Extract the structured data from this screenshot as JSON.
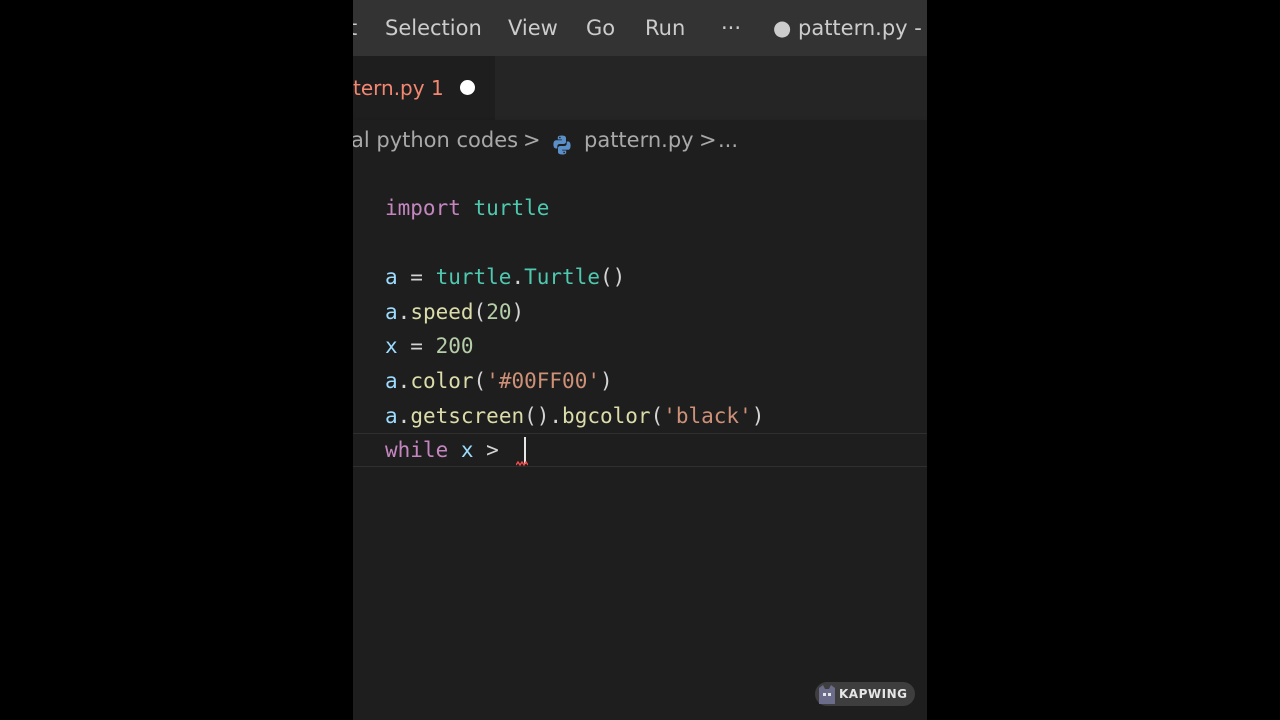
{
  "menubar": {
    "items": [
      "Selection",
      "View",
      "Go",
      "Run"
    ],
    "overflow": "···",
    "left_fragment": "t",
    "title": "● pattern.py - P"
  },
  "tab": {
    "label": "tern.py 1",
    "dirty_indicator": "●"
  },
  "breadcrumb": {
    "folder": "al python codes",
    "separator": ">",
    "file": "pattern.py",
    "trail": "..."
  },
  "editor": {
    "lines": [
      [
        {
          "t": "import",
          "c": "kw"
        },
        {
          "t": " ",
          "c": "op"
        },
        {
          "t": "turtle",
          "c": "mod"
        }
      ],
      [],
      [
        {
          "t": "a",
          "c": "var"
        },
        {
          "t": " = ",
          "c": "op"
        },
        {
          "t": "turtle",
          "c": "mod"
        },
        {
          "t": ".",
          "c": "op"
        },
        {
          "t": "Turtle",
          "c": "mod"
        },
        {
          "t": "()",
          "c": "op"
        }
      ],
      [
        {
          "t": "a",
          "c": "var"
        },
        {
          "t": ".",
          "c": "op"
        },
        {
          "t": "speed",
          "c": "fn"
        },
        {
          "t": "(",
          "c": "op"
        },
        {
          "t": "20",
          "c": "num"
        },
        {
          "t": ")",
          "c": "op"
        }
      ],
      [
        {
          "t": "x",
          "c": "var"
        },
        {
          "t": " = ",
          "c": "op"
        },
        {
          "t": "200",
          "c": "num"
        }
      ],
      [
        {
          "t": "a",
          "c": "var"
        },
        {
          "t": ".",
          "c": "op"
        },
        {
          "t": "color",
          "c": "fn"
        },
        {
          "t": "(",
          "c": "op"
        },
        {
          "t": "'#00FF00'",
          "c": "str"
        },
        {
          "t": ")",
          "c": "op"
        }
      ],
      [
        {
          "t": "a",
          "c": "var"
        },
        {
          "t": ".",
          "c": "op"
        },
        {
          "t": "getscreen",
          "c": "fn"
        },
        {
          "t": "().",
          "c": "op"
        },
        {
          "t": "bgcolor",
          "c": "fn"
        },
        {
          "t": "(",
          "c": "op"
        },
        {
          "t": "'black'",
          "c": "str"
        },
        {
          "t": ")",
          "c": "op"
        }
      ],
      [
        {
          "t": "while",
          "c": "kw"
        },
        {
          "t": " ",
          "c": "op"
        },
        {
          "t": "x",
          "c": "var"
        },
        {
          "t": " > ",
          "c": "op"
        }
      ]
    ]
  },
  "watermark": {
    "text": "KAPWING"
  },
  "colors": {
    "background": "#000000",
    "editor_bg": "#1e1e1e",
    "menubar_bg": "#333333",
    "tab_label": "#f48771",
    "keyword": "#c586c0",
    "module": "#4ec9b0",
    "variable": "#9cdcfe",
    "function": "#dcdcaa",
    "number": "#b5cea8",
    "string": "#ce9178"
  },
  "icons": {
    "breadcrumb_file": "python-icon",
    "watermark_logo": "kapwing-cat-icon"
  }
}
